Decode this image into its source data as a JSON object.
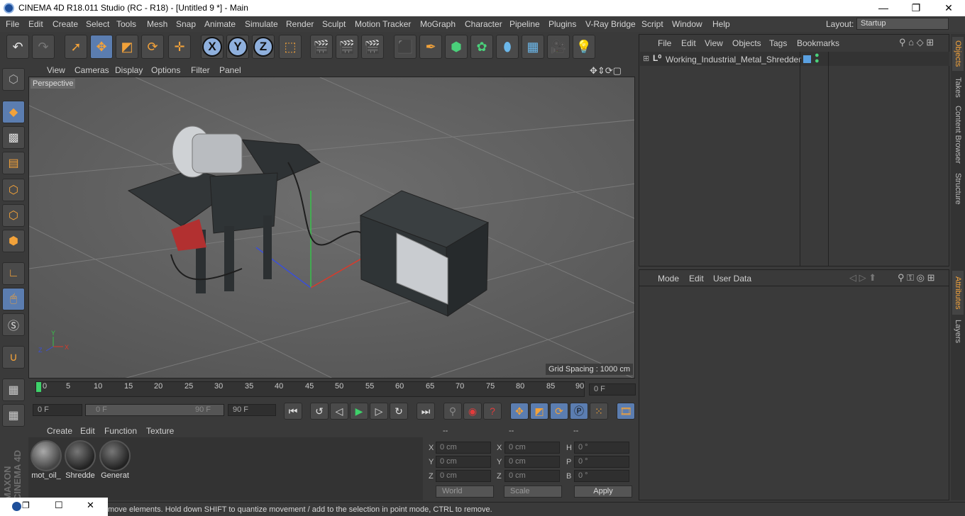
{
  "window": {
    "title": "CINEMA 4D R18.011 Studio (RC - R18) - [Untitled 9 *] - Main",
    "minimize": "—",
    "restore": "❐",
    "close": "✕"
  },
  "menu": [
    "File",
    "Edit",
    "Create",
    "Select",
    "Tools",
    "Mesh",
    "Snap",
    "Animate",
    "Simulate",
    "Render",
    "Sculpt",
    "Motion Tracker",
    "MoGraph",
    "Character",
    "Pipeline",
    "Plugins",
    "V-Ray Bridge",
    "Script",
    "Window",
    "Help"
  ],
  "layout": {
    "label": "Layout:",
    "value": "Startup"
  },
  "toolbar": {
    "x": "X",
    "y": "Y",
    "z": "Z"
  },
  "viewport": {
    "menu": [
      "View",
      "Cameras",
      "Display",
      "Options",
      "Filter",
      "Panel"
    ],
    "label": "Perspective",
    "grid_spacing": "Grid Spacing : 1000 cm"
  },
  "timeline": {
    "ticks": [
      "0",
      "5",
      "10",
      "15",
      "20",
      "25",
      "30",
      "35",
      "40",
      "45",
      "50",
      "55",
      "60",
      "65",
      "70",
      "75",
      "80",
      "85",
      "90"
    ],
    "current": "0 F",
    "start": "0 F",
    "range_start": "0 F",
    "range_end": "90 F",
    "end": "90 F"
  },
  "materials": {
    "menu": [
      "Create",
      "Edit",
      "Function",
      "Texture"
    ],
    "items": [
      "mot_oil_",
      "Shredde",
      "Generat"
    ]
  },
  "coords": {
    "headers": [
      "--",
      "--",
      "--"
    ],
    "rows": [
      {
        "a": "X",
        "av": "0 cm",
        "b": "X",
        "bv": "0 cm",
        "c": "H",
        "cv": "0 °"
      },
      {
        "a": "Y",
        "av": "0 cm",
        "b": "Y",
        "bv": "0 cm",
        "c": "P",
        "cv": "0 °"
      },
      {
        "a": "Z",
        "av": "0 cm",
        "b": "Z",
        "bv": "0 cm",
        "c": "B",
        "cv": "0 °"
      }
    ],
    "world": "World",
    "scale": "Scale",
    "apply": "Apply"
  },
  "objects": {
    "menu": [
      "File",
      "Edit",
      "View",
      "Objects",
      "Tags",
      "Bookmarks"
    ],
    "item": "Working_Industrial_Metal_Shredder"
  },
  "attributes": {
    "menu": [
      "Mode",
      "Edit",
      "User Data"
    ]
  },
  "side_tabs": [
    "Objects",
    "Takes",
    "Content Browser",
    "Structure",
    "Attributes",
    "Layers"
  ],
  "status": "move elements. Hold down SHIFT to quantize movement / add to the selection in point mode, CTRL to remove.",
  "brand": "MAXON CINEMA 4D"
}
